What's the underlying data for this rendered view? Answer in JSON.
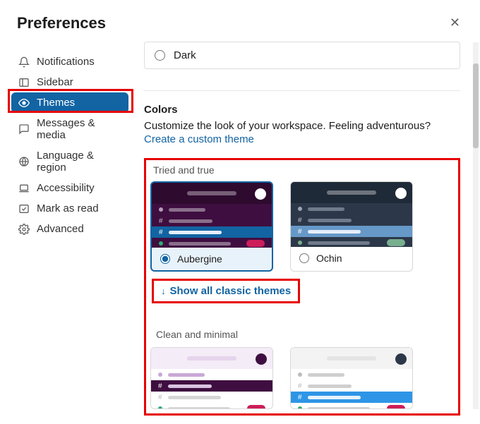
{
  "title": "Preferences",
  "sidebar": {
    "items": [
      {
        "label": "Notifications"
      },
      {
        "label": "Sidebar"
      },
      {
        "label": "Themes"
      },
      {
        "label": "Messages & media"
      },
      {
        "label": "Language & region"
      },
      {
        "label": "Accessibility"
      },
      {
        "label": "Mark as read"
      },
      {
        "label": "Advanced"
      }
    ]
  },
  "dark_label": "Dark",
  "colors": {
    "heading": "Colors",
    "sub": "Customize the look of your workspace. Feeling adventurous?",
    "link": "Create a custom theme"
  },
  "groups": {
    "tried": "Tried and true",
    "clean": "Clean and minimal"
  },
  "themes": {
    "aubergine": "Aubergine",
    "ochin": "Ochin"
  },
  "show_all": "Show all classic themes",
  "palette": {
    "aubergine_dark": "#3f0e40",
    "aubergine_highlight": "#1264a3",
    "aubergine_pill": "#cd1e59",
    "ochin_dark": "#2c3849",
    "ochin_highlight": "#6698c8",
    "ochin_pill": "#78af8f"
  }
}
